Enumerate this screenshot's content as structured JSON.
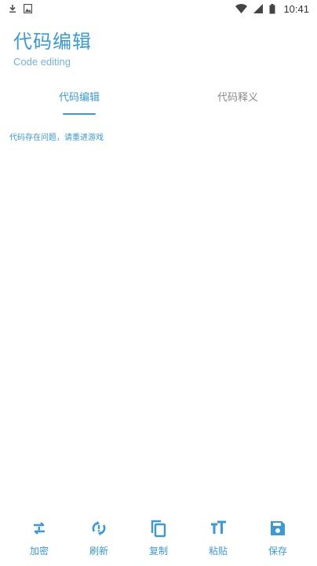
{
  "status_bar": {
    "time": "10:41",
    "left_icons": [
      "download-icon",
      "image-icon"
    ],
    "right_icons": [
      "wifi-icon",
      "signal-icon",
      "battery-icon"
    ]
  },
  "header": {
    "title": "代码编辑",
    "subtitle": "Code editing"
  },
  "tabs": [
    {
      "label": "代码编辑",
      "active": true
    },
    {
      "label": "代码释义",
      "active": false
    }
  ],
  "content": {
    "message": "代码存在问题，请重进游戏"
  },
  "toolbar": {
    "items": [
      {
        "label": "加密",
        "icon": "encrypt-icon"
      },
      {
        "label": "刷新",
        "icon": "refresh-icon"
      },
      {
        "label": "复制",
        "icon": "copy-icon"
      },
      {
        "label": "粘贴",
        "icon": "paste-icon"
      },
      {
        "label": "保存",
        "icon": "save-icon"
      }
    ]
  },
  "colors": {
    "accent": "#3a9ad9",
    "inactive_tab": "#8a8a8a",
    "background": "#ffffff"
  }
}
